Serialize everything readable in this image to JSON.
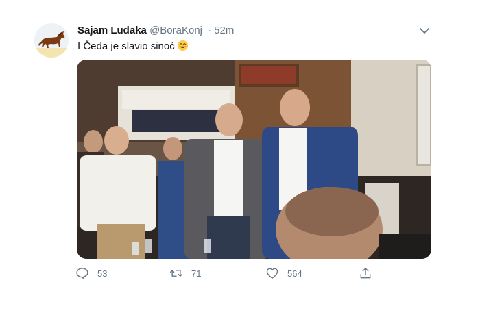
{
  "tweet": {
    "author_name": "Sajam Ludaka",
    "handle": "@BoraKonj",
    "separator": "·",
    "time": "52m",
    "text": "I Čeda je slavio sinoć",
    "emoji": "smiling-face-icon",
    "avatar_icon": "horse-icon",
    "menu_icon": "chevron-down-icon"
  },
  "actions": {
    "reply": {
      "icon": "reply-icon",
      "count": "53"
    },
    "retweet": {
      "icon": "retweet-icon",
      "count": "71"
    },
    "like": {
      "icon": "heart-icon",
      "count": "564"
    },
    "share": {
      "icon": "share-icon",
      "count": ""
    }
  },
  "colors": {
    "text": "#14171a",
    "secondary": "#657786",
    "background": "#ffffff"
  }
}
